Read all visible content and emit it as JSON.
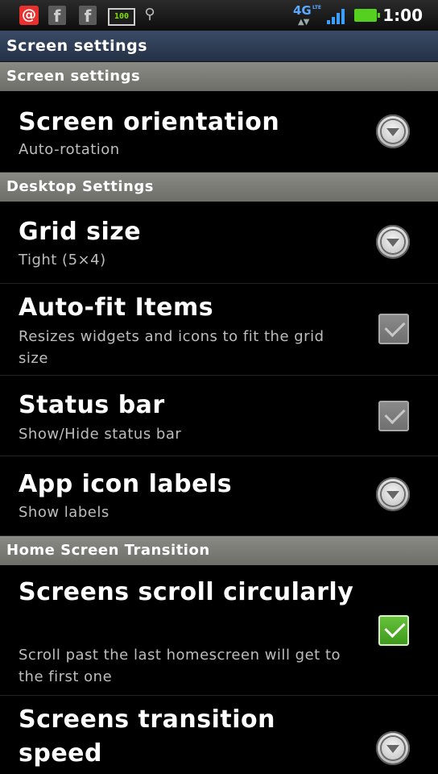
{
  "status_bar": {
    "time": "1:00",
    "network": "4G",
    "network_sub": "LTE",
    "notif_mail": "@",
    "notif_fb": "f",
    "notif_battery_text": "100",
    "usb_symbol": "⚲"
  },
  "title_bar": {
    "title": "Screen settings"
  },
  "sections": [
    {
      "label": "Screen settings"
    },
    {
      "label": "Desktop Settings"
    },
    {
      "label": "Home Screen Transition"
    }
  ],
  "items": {
    "screen_orientation": {
      "title": "Screen orientation",
      "summary": "Auto-rotation"
    },
    "grid_size": {
      "title": "Grid size",
      "summary": "Tight (5×4)"
    },
    "auto_fit": {
      "title": "Auto-fit Items",
      "summary": "Resizes widgets and icons to fit the grid size",
      "checked": false
    },
    "status_bar": {
      "title": "Status bar",
      "summary": "Show/Hide status bar",
      "checked": false
    },
    "app_icon_labels": {
      "title": "App icon labels",
      "summary": "Show labels"
    },
    "screens_scroll": {
      "title": "Screens scroll circularly",
      "summary": "Scroll past the last homescreen will get to the first one",
      "checked": true
    },
    "transition_speed": {
      "title": "Screens transition speed"
    }
  },
  "colors": {
    "section_bg": "#7c7c76",
    "checkbox_on": "#4caa26",
    "title_bar": "#2f3d55"
  }
}
